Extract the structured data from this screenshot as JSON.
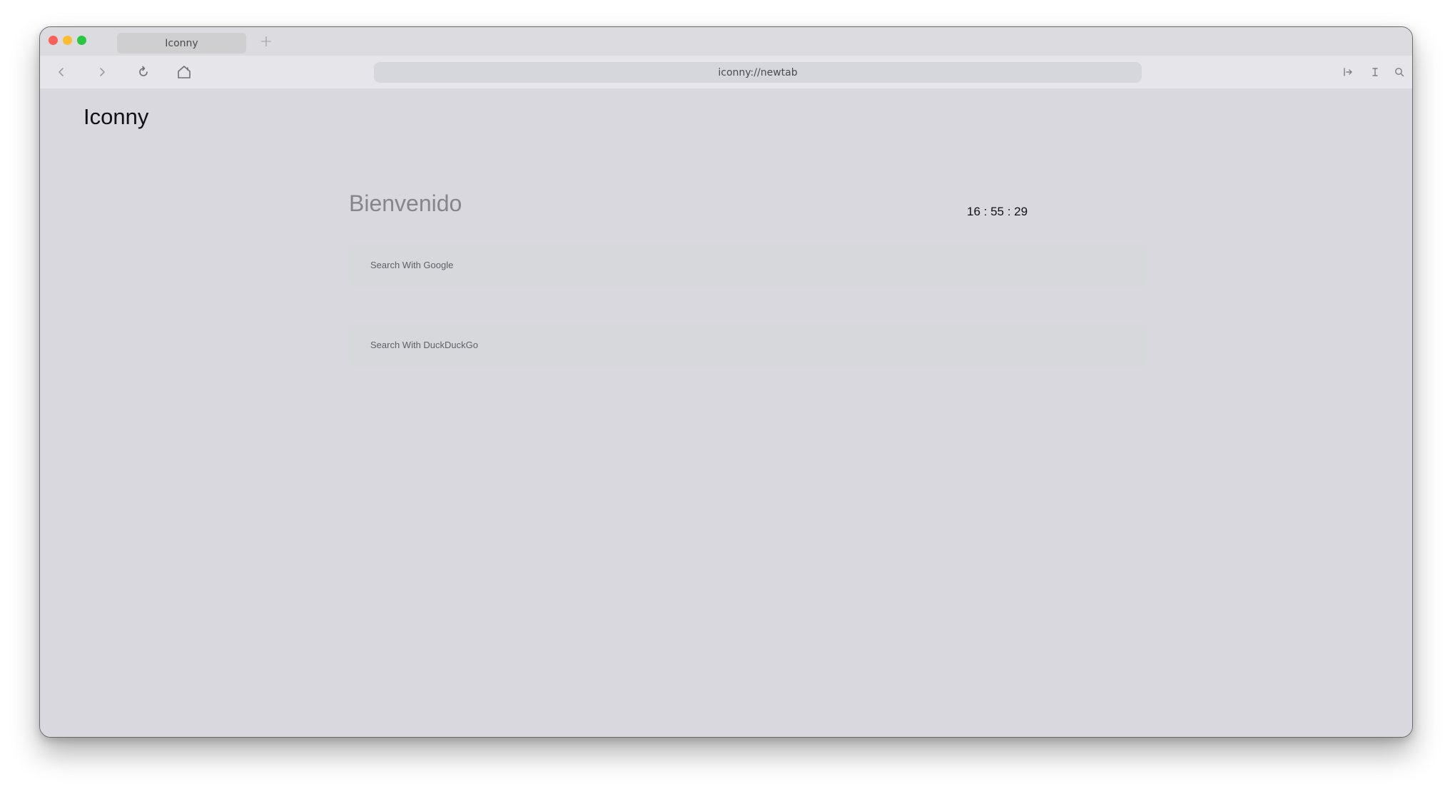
{
  "browser": {
    "tab_title": "Iconny",
    "new_tab_symbol": "+",
    "address": "iconny://newtab",
    "icons": {
      "back": "chevron-left-icon",
      "forward": "chevron-right-icon",
      "reload": "reload-icon",
      "home": "home-icon",
      "share": "share-icon",
      "reader": "text-cursor-icon",
      "search": "search-icon"
    },
    "traffic_lights": {
      "close": "#fe5f57",
      "minimize": "#febc2e",
      "maximize": "#28c840"
    }
  },
  "page": {
    "brand": "Iconny",
    "welcome": "Bienvenido",
    "clock": "16 : 55 : 29",
    "search_google": {
      "placeholder": "Search With Google"
    },
    "search_duckduckgo": {
      "placeholder": "Search With DuckDuckGo"
    }
  }
}
